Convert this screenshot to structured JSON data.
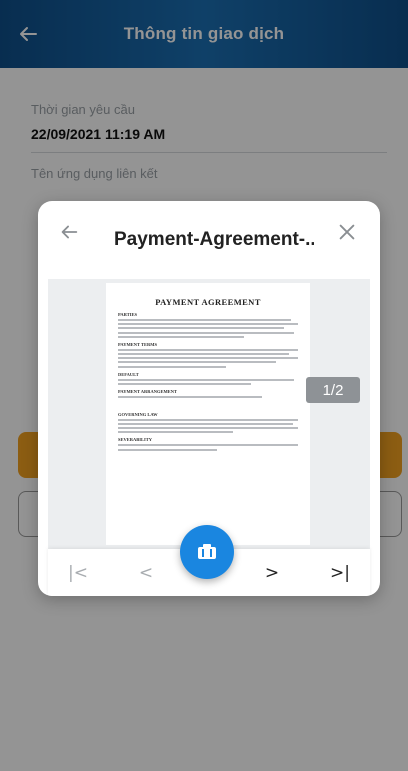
{
  "header": {
    "title": "Thông tin giao dịch"
  },
  "fields": [
    {
      "label": "Thời gian yêu cầu",
      "value": "22/09/2021 11:19 AM"
    },
    {
      "label": "Tên ứng dụng liên kết",
      "value": ""
    }
  ],
  "modal": {
    "title": "Payment-Agreement-...",
    "page_indicator": "1/2",
    "document": {
      "heading": "PAYMENT AGREEMENT",
      "sections": [
        "PARTIES",
        "PAYMENT TERMS",
        "DEFAULT",
        "PAYMENT ARRANGEMENT",
        "GOVERNING LAW",
        "SEVERABILITY"
      ]
    },
    "nav": {
      "first": "|<",
      "prev": "<",
      "next": ">",
      "last": ">|"
    }
  },
  "icons": {
    "back": "arrow-left-icon",
    "close": "close-icon",
    "fab": "camera-icon"
  },
  "colors": {
    "header": "#1b6fb3",
    "accent": "#f2a01f",
    "fab": "#1a86e0"
  }
}
